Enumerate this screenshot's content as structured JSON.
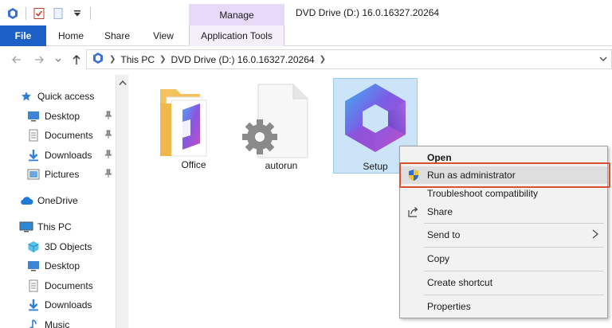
{
  "window": {
    "title": "DVD Drive (D:) 16.0.16327.20264",
    "context_group": "Manage"
  },
  "ribbon": {
    "tabs": [
      {
        "label": "File"
      },
      {
        "label": "Home"
      },
      {
        "label": "Share"
      },
      {
        "label": "View"
      },
      {
        "label": "Application Tools"
      }
    ]
  },
  "address": {
    "crumbs": [
      "This PC",
      "DVD Drive (D:) 16.0.16327.20264"
    ]
  },
  "navpane": {
    "items": [
      {
        "label": "Quick access",
        "icon": "star-icon"
      },
      {
        "label": "Desktop",
        "icon": "desktop-icon",
        "pinned": true
      },
      {
        "label": "Documents",
        "icon": "documents-icon",
        "pinned": true
      },
      {
        "label": "Downloads",
        "icon": "downloads-icon",
        "pinned": true
      },
      {
        "label": "Pictures",
        "icon": "pictures-icon",
        "pinned": true
      },
      {
        "label": "OneDrive",
        "icon": "cloud-icon"
      },
      {
        "label": "This PC",
        "icon": "computer-icon"
      },
      {
        "label": "3D Objects",
        "icon": "3d-objects-icon"
      },
      {
        "label": "Desktop",
        "icon": "desktop-icon"
      },
      {
        "label": "Documents",
        "icon": "documents-icon"
      },
      {
        "label": "Downloads",
        "icon": "downloads-icon"
      },
      {
        "label": "Music",
        "icon": "music-icon"
      }
    ]
  },
  "files": [
    {
      "name": "Office",
      "icon": "folder-office-icon"
    },
    {
      "name": "autorun",
      "icon": "settings-file-icon"
    },
    {
      "name": "Setup",
      "icon": "office-setup-icon",
      "selected": true
    }
  ],
  "context_menu": {
    "items": [
      {
        "label": "Open",
        "bold": true
      },
      {
        "label": "Run as administrator",
        "icon": "uac-shield-icon",
        "highlighted": true
      },
      {
        "label": "Troubleshoot compatibility"
      },
      {
        "label": "Share",
        "icon": "share-icon"
      },
      {
        "label": "Send to",
        "submenu": true
      },
      {
        "label": "Copy"
      },
      {
        "label": "Create shortcut"
      },
      {
        "label": "Properties"
      }
    ]
  },
  "colors": {
    "file_tab": "#1b5fc7",
    "manage_context": "#e8d9f8",
    "selection": "#cce4f7",
    "callout_border": "#d9522f"
  }
}
